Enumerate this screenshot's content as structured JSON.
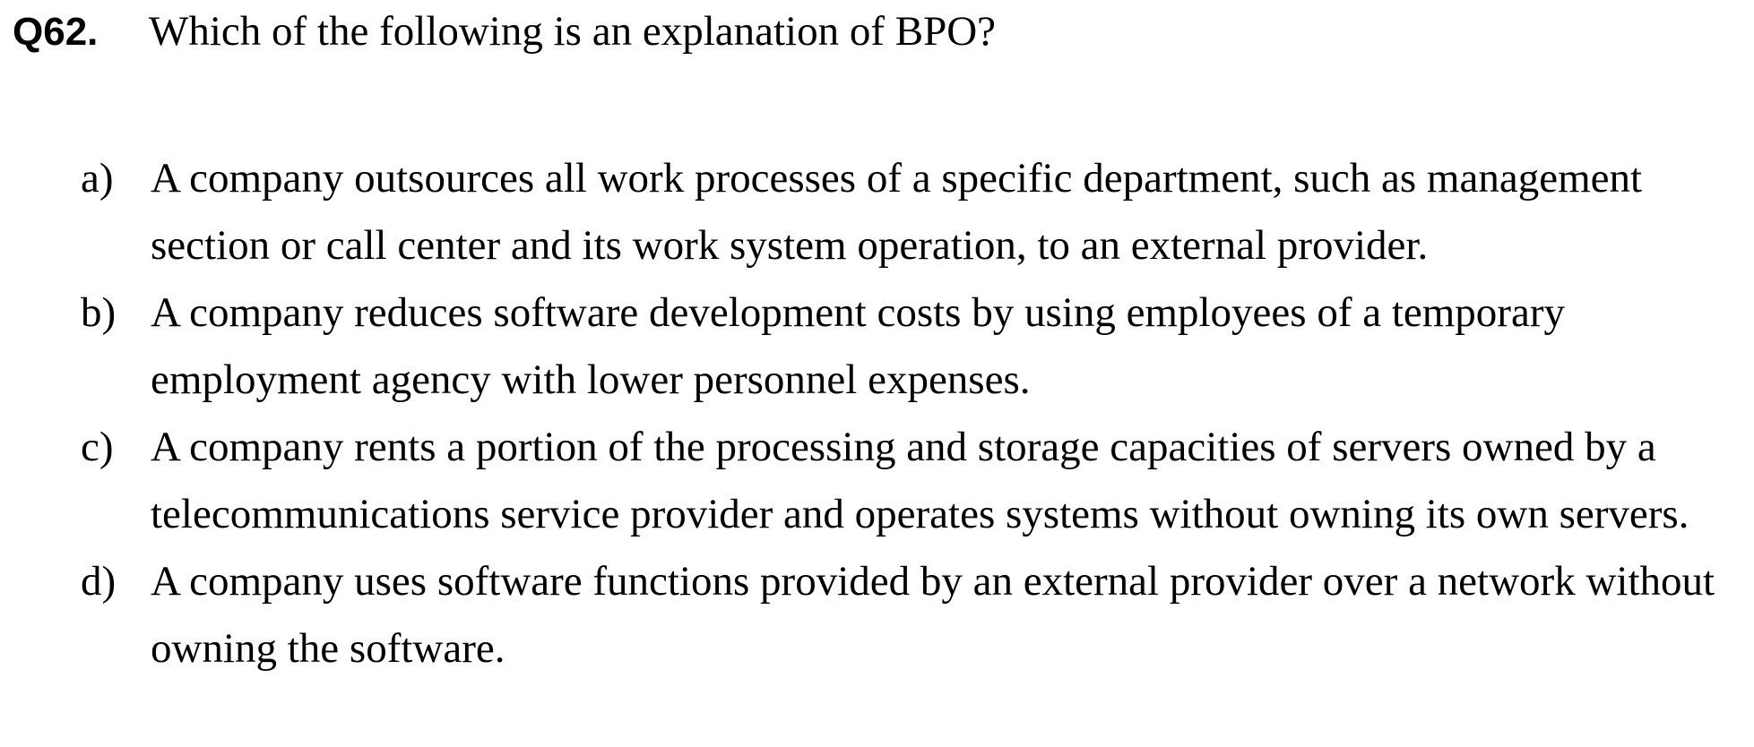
{
  "question": {
    "number": "Q62.",
    "text": "Which of the following is an explanation of BPO?"
  },
  "options": [
    {
      "letter": "a)",
      "text": "A company outsources all work processes of a specific department, such as management section or call center and its work system operation, to an external provider."
    },
    {
      "letter": "b)",
      "text": "A company reduces software development costs by using employees of a temporary employment agency with lower personnel expenses."
    },
    {
      "letter": "c)",
      "text": "A company rents a portion of the processing and storage capacities of servers owned by a telecommunications service provider and operates systems without owning its own servers."
    },
    {
      "letter": "d)",
      "text": "A company uses software functions provided by an external provider over a network without owning the software."
    }
  ]
}
